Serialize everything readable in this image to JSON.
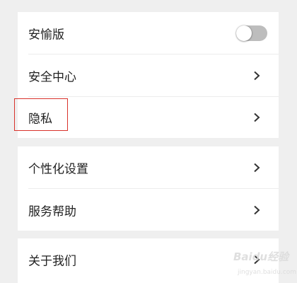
{
  "settings": {
    "group1": {
      "rows": [
        {
          "label": "安愉版",
          "toggle_state": "off"
        },
        {
          "label": "安全中心"
        },
        {
          "label": "隐私"
        }
      ]
    },
    "group2": {
      "rows": [
        {
          "label": "个性化设置"
        },
        {
          "label": "服务帮助"
        }
      ]
    },
    "group3": {
      "rows": [
        {
          "label": "关于我们"
        }
      ]
    }
  },
  "annotation": {
    "highlight_target": "隐私",
    "color": "#d9322b"
  },
  "watermark": {
    "brand": "Baidu经验",
    "url": "jingyan.baidu.com"
  },
  "colors": {
    "background": "#efefef",
    "panel": "#ffffff",
    "text": "#222222",
    "toggle_off": "#bdbdbd"
  }
}
